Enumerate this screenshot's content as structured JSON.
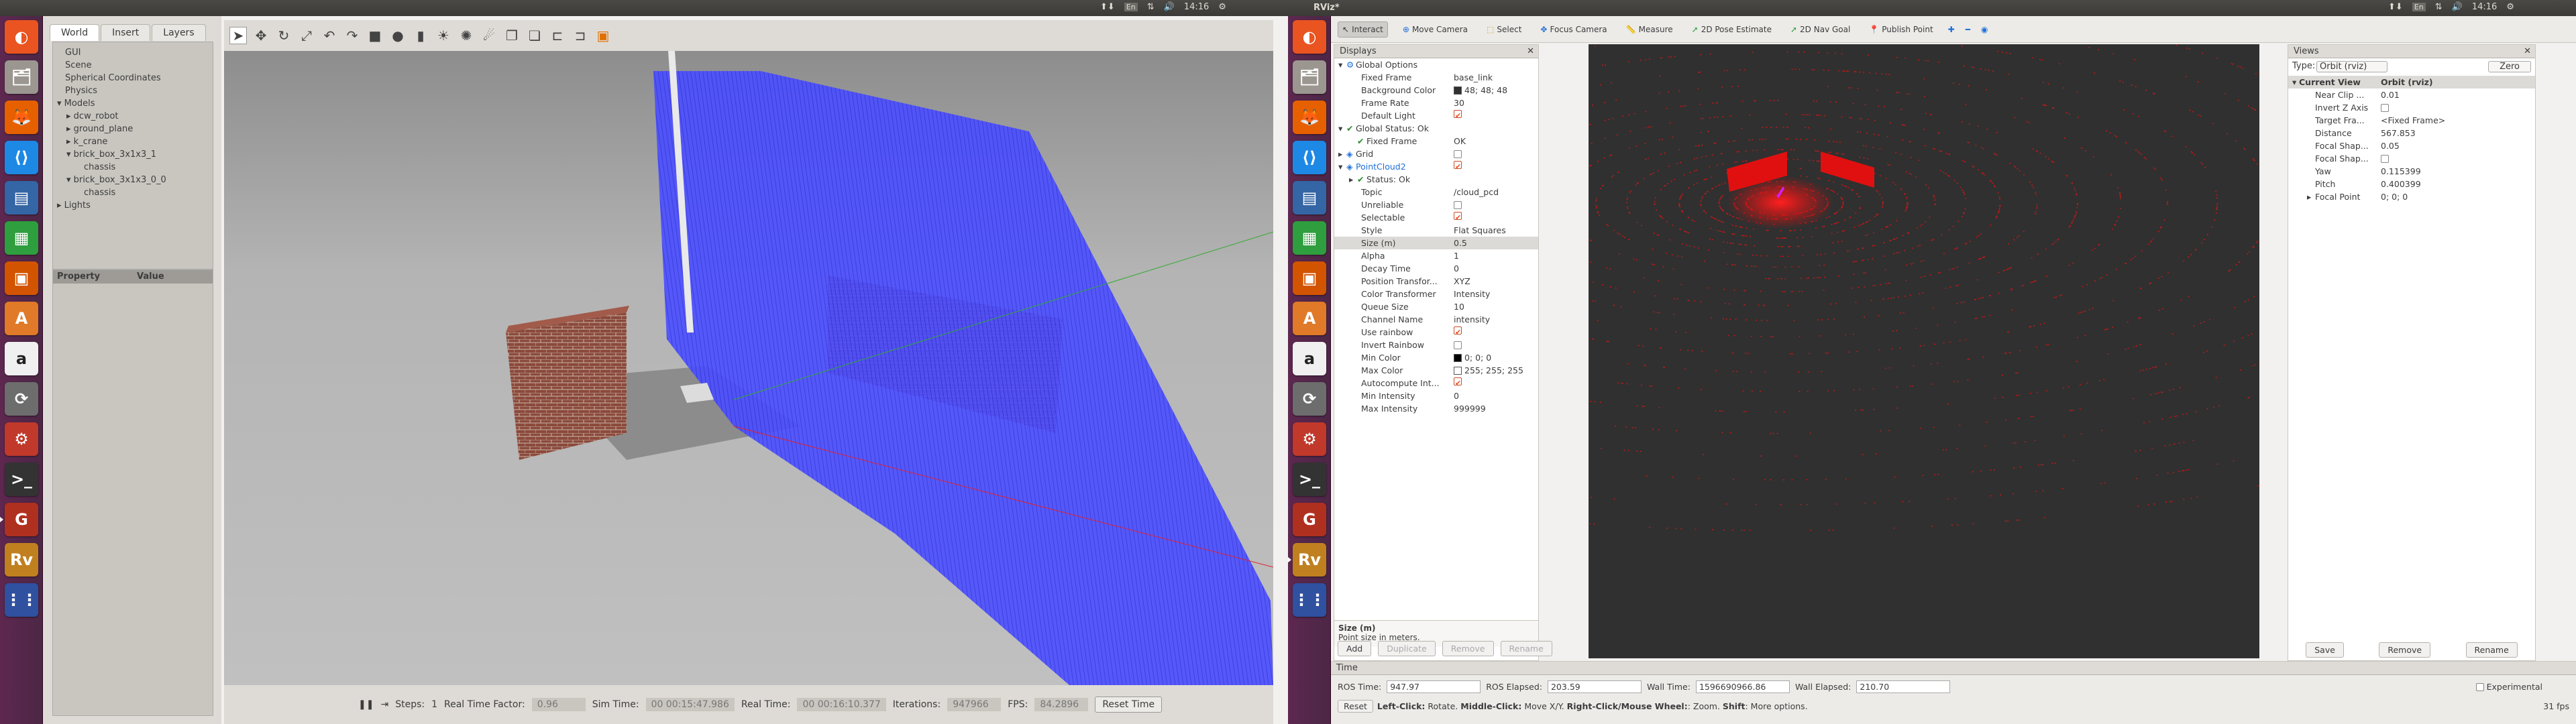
{
  "left": {
    "topbar": {
      "time": "14:16",
      "lang": "En"
    },
    "launcher_icons": [
      "ubuntu-dash-icon",
      "files-icon",
      "firefox-icon",
      "vscode-icon",
      "libreoffice-writer-icon",
      "libreoffice-calc-icon",
      "libreoffice-impress-icon",
      "software-center-icon",
      "amazon-icon",
      "updater-icon",
      "settings-icon",
      "terminal-icon",
      "gazebo-icon",
      "rviz-icon",
      "apps-grid-icon"
    ],
    "tabs": [
      "World",
      "Insert",
      "Layers"
    ],
    "tree": [
      {
        "label": "GUI",
        "indent": 0,
        "arrow": ""
      },
      {
        "label": "Scene",
        "indent": 0,
        "arrow": ""
      },
      {
        "label": "Spherical Coordinates",
        "indent": 0,
        "arrow": ""
      },
      {
        "label": "Physics",
        "indent": 0,
        "arrow": ""
      },
      {
        "label": "Models",
        "indent": 0,
        "arrow": "▾"
      },
      {
        "label": "dcw_robot",
        "indent": 1,
        "arrow": "▸"
      },
      {
        "label": "ground_plane",
        "indent": 1,
        "arrow": "▸"
      },
      {
        "label": "k_crane",
        "indent": 1,
        "arrow": "▸"
      },
      {
        "label": "brick_box_3x1x3_1",
        "indent": 1,
        "arrow": "▾"
      },
      {
        "label": "chassis",
        "indent": 2,
        "arrow": ""
      },
      {
        "label": "brick_box_3x1x3_0_0",
        "indent": 1,
        "arrow": "▾"
      },
      {
        "label": "chassis",
        "indent": 2,
        "arrow": ""
      },
      {
        "label": "Lights",
        "indent": 0,
        "arrow": "▸"
      }
    ],
    "prop_headers": {
      "property": "Property",
      "value": "Value"
    },
    "bottom": {
      "steps_label": "Steps:",
      "steps_value": "1",
      "rtf_label": "Real Time Factor:",
      "rtf_value": "0.96",
      "sim_label": "Sim Time:",
      "sim_value": "00 00:15:47.986",
      "real_label": "Real Time:",
      "real_value": "00 00:16:10.377",
      "iter_label": "Iterations:",
      "iter_value": "947966",
      "fps_label": "FPS:",
      "fps_value": "84.2896",
      "reset_label": "Reset Time"
    }
  },
  "right": {
    "topbar": {
      "app_title": "RViz*",
      "time": "14:16",
      "lang": "En"
    },
    "tools": [
      "Interact",
      "Move Camera",
      "Select",
      "Focus Camera",
      "Measure",
      "2D Pose Estimate",
      "2D Nav Goal",
      "Publish Point"
    ],
    "displays_title": "Displays",
    "rows": [
      {
        "k": "Global Options",
        "v": "",
        "indent": 1,
        "arrow": "▾",
        "check": "",
        "color": "",
        "ctrl": "",
        "hl": false,
        "blue": false,
        "bold": false
      },
      {
        "k": "Fixed Frame",
        "v": "base_link",
        "indent": 2,
        "arrow": "",
        "check": "",
        "color": "",
        "ctrl": "",
        "hl": false,
        "blue": false,
        "bold": false
      },
      {
        "k": "Background Color",
        "v": "48; 48; 48",
        "indent": 2,
        "arrow": "",
        "check": "",
        "color": "#303030",
        "ctrl": "",
        "hl": false,
        "blue": false,
        "bold": false
      },
      {
        "k": "Frame Rate",
        "v": "30",
        "indent": 2,
        "arrow": "",
        "check": "",
        "color": "",
        "ctrl": "",
        "hl": false,
        "blue": false,
        "bold": false
      },
      {
        "k": "Default Light",
        "v": "",
        "indent": 2,
        "arrow": "",
        "check": "",
        "color": "",
        "ctrl": "on",
        "hl": false,
        "blue": false,
        "bold": false
      },
      {
        "k": "Global Status: Ok",
        "v": "",
        "indent": 1,
        "arrow": "▾",
        "check": "✔",
        "color": "",
        "ctrl": "",
        "hl": false,
        "blue": false,
        "bold": false
      },
      {
        "k": "Fixed Frame",
        "v": "OK",
        "indent": 2,
        "arrow": "",
        "check": "✔",
        "color": "",
        "ctrl": "",
        "hl": false,
        "blue": false,
        "bold": false
      },
      {
        "k": "Grid",
        "v": "",
        "indent": 1,
        "arrow": "▸",
        "check": "",
        "color": "",
        "ctrl": "off",
        "hl": false,
        "blue": false,
        "bold": false
      },
      {
        "k": "PointCloud2",
        "v": "",
        "indent": 1,
        "arrow": "▾",
        "check": "",
        "color": "",
        "ctrl": "on",
        "hl": false,
        "blue": true,
        "bold": false
      },
      {
        "k": "Status: Ok",
        "v": "",
        "indent": 2,
        "arrow": "▸",
        "check": "✔",
        "color": "",
        "ctrl": "",
        "hl": false,
        "blue": false,
        "bold": false
      },
      {
        "k": "Topic",
        "v": "/cloud_pcd",
        "indent": 2,
        "arrow": "",
        "check": "",
        "color": "",
        "ctrl": "",
        "hl": false,
        "blue": false,
        "bold": false
      },
      {
        "k": "Unreliable",
        "v": "",
        "indent": 2,
        "arrow": "",
        "check": "",
        "color": "",
        "ctrl": "off",
        "hl": false,
        "blue": false,
        "bold": false
      },
      {
        "k": "Selectable",
        "v": "",
        "indent": 2,
        "arrow": "",
        "check": "",
        "color": "",
        "ctrl": "on",
        "hl": false,
        "blue": false,
        "bold": false
      },
      {
        "k": "Style",
        "v": "Flat Squares",
        "indent": 2,
        "arrow": "",
        "check": "",
        "color": "",
        "ctrl": "",
        "hl": false,
        "blue": false,
        "bold": false
      },
      {
        "k": "Size (m)",
        "v": "0.5",
        "indent": 2,
        "arrow": "",
        "check": "",
        "color": "",
        "ctrl": "",
        "hl": true,
        "blue": false,
        "bold": false
      },
      {
        "k": "Alpha",
        "v": "1",
        "indent": 2,
        "arrow": "",
        "check": "",
        "color": "",
        "ctrl": "",
        "hl": false,
        "blue": false,
        "bold": false
      },
      {
        "k": "Decay Time",
        "v": "0",
        "indent": 2,
        "arrow": "",
        "check": "",
        "color": "",
        "ctrl": "",
        "hl": false,
        "blue": false,
        "bold": false
      },
      {
        "k": "Position Transfor...",
        "v": "XYZ",
        "indent": 2,
        "arrow": "",
        "check": "",
        "color": "",
        "ctrl": "",
        "hl": false,
        "blue": false,
        "bold": false
      },
      {
        "k": "Color Transformer",
        "v": "Intensity",
        "indent": 2,
        "arrow": "",
        "check": "",
        "color": "",
        "ctrl": "",
        "hl": false,
        "blue": false,
        "bold": false
      },
      {
        "k": "Queue Size",
        "v": "10",
        "indent": 2,
        "arrow": "",
        "check": "",
        "color": "",
        "ctrl": "",
        "hl": false,
        "blue": false,
        "bold": false
      },
      {
        "k": "Channel Name",
        "v": "intensity",
        "indent": 2,
        "arrow": "",
        "check": "",
        "color": "",
        "ctrl": "",
        "hl": false,
        "blue": false,
        "bold": false
      },
      {
        "k": "Use rainbow",
        "v": "",
        "indent": 2,
        "arrow": "",
        "check": "",
        "color": "",
        "ctrl": "on",
        "hl": false,
        "blue": false,
        "bold": false
      },
      {
        "k": "Invert Rainbow",
        "v": "",
        "indent": 2,
        "arrow": "",
        "check": "",
        "color": "",
        "ctrl": "off",
        "hl": false,
        "blue": false,
        "bold": false
      },
      {
        "k": "Min Color",
        "v": "0; 0; 0",
        "indent": 2,
        "arrow": "",
        "check": "",
        "color": "#000000",
        "ctrl": "",
        "hl": false,
        "blue": false,
        "bold": false
      },
      {
        "k": "Max Color",
        "v": "255; 255; 255",
        "indent": 2,
        "arrow": "",
        "check": "",
        "color": "#ffffff",
        "ctrl": "",
        "hl": false,
        "blue": false,
        "bold": false
      },
      {
        "k": "Autocompute Int...",
        "v": "",
        "indent": 2,
        "arrow": "",
        "check": "",
        "color": "",
        "ctrl": "on",
        "hl": false,
        "blue": false,
        "bold": false
      },
      {
        "k": "Min Intensity",
        "v": "0",
        "indent": 2,
        "arrow": "",
        "check": "",
        "color": "",
        "ctrl": "",
        "hl": false,
        "blue": false,
        "bold": false
      },
      {
        "k": "Max Intensity",
        "v": "999999",
        "indent": 2,
        "arrow": "",
        "check": "",
        "color": "",
        "ctrl": "",
        "hl": false,
        "blue": false,
        "bold": false
      }
    ],
    "help": {
      "title": "Size (m)",
      "text": "Point size in meters."
    },
    "display_buttons": [
      "Add",
      "Duplicate",
      "Remove",
      "Rename"
    ],
    "views": {
      "title": "Views",
      "type_label": "Type:",
      "type_value": "Orbit (rviz)",
      "zero_label": "Zero",
      "current_label": "Current View",
      "current_value": "Orbit (rviz)",
      "rows": [
        {
          "k": "Near Clip ...",
          "v": "0.01",
          "cb": ""
        },
        {
          "k": "Invert Z Axis",
          "v": "",
          "cb": "off"
        },
        {
          "k": "Target Fra...",
          "v": "<Fixed Frame>",
          "cb": ""
        },
        {
          "k": "Distance",
          "v": "567.853",
          "cb": ""
        },
        {
          "k": "Focal Shap...",
          "v": "0.05",
          "cb": ""
        },
        {
          "k": "Focal Shap...",
          "v": "",
          "cb": "off"
        },
        {
          "k": "Yaw",
          "v": "0.115399",
          "cb": ""
        },
        {
          "k": "Pitch",
          "v": "0.400399",
          "cb": ""
        },
        {
          "k": "Focal Point",
          "v": "0; 0; 0",
          "cb": ""
        }
      ],
      "buttons": [
        "Save",
        "Remove",
        "Rename"
      ]
    },
    "time": {
      "title": "Time",
      "ros_time_label": "ROS Time:",
      "ros_time": "947.97",
      "ros_elapsed_label": "ROS Elapsed:",
      "ros_elapsed": "203.59",
      "wall_time_label": "Wall Time:",
      "wall_time": "1596690966.86",
      "wall_elapsed_label": "Wall Elapsed:",
      "wall_elapsed": "210.70",
      "experimental": "Experimental",
      "reset": "Reset",
      "hint_bold1": "Left-Click:",
      "hint1": " Rotate. ",
      "hint_bold2": "Middle-Click:",
      "hint2": " Move X/Y. ",
      "hint_bold3": "Right-Click/Mouse Wheel:",
      "hint3": ": Zoom. ",
      "hint_bold4": "Shift",
      "hint4": ": More options.",
      "fps": "31 fps"
    }
  }
}
